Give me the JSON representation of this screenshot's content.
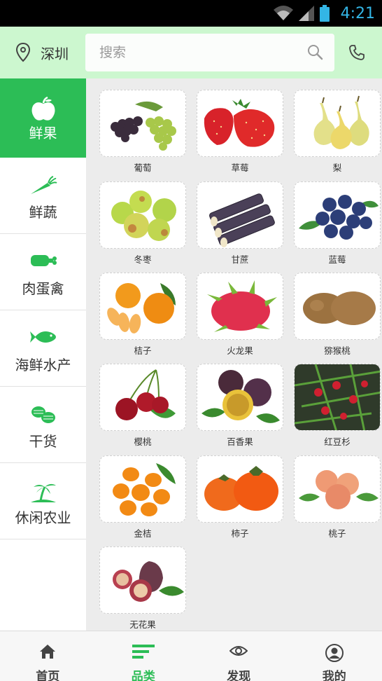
{
  "status": {
    "time": "4:21"
  },
  "header": {
    "city": "深圳",
    "search_placeholder": "搜索"
  },
  "sidebar": {
    "items": [
      {
        "label": "鲜果",
        "icon": "apple-icon",
        "active": true
      },
      {
        "label": "鲜蔬",
        "icon": "carrot-icon",
        "active": false
      },
      {
        "label": "肉蛋禽",
        "icon": "meat-icon",
        "active": false
      },
      {
        "label": "海鲜水产",
        "icon": "fish-icon",
        "active": false
      },
      {
        "label": "干货",
        "icon": "peanut-icon",
        "active": false
      },
      {
        "label": "休闲农业",
        "icon": "palm-island-icon",
        "active": false
      }
    ]
  },
  "products": [
    {
      "name": "葡萄"
    },
    {
      "name": "草莓"
    },
    {
      "name": "梨"
    },
    {
      "name": "冬枣"
    },
    {
      "name": "甘蔗"
    },
    {
      "name": "蓝莓"
    },
    {
      "name": "桔子"
    },
    {
      "name": "火龙果"
    },
    {
      "name": "猕猴桃"
    },
    {
      "name": "樱桃"
    },
    {
      "name": "百香果"
    },
    {
      "name": "红豆杉"
    },
    {
      "name": "金桔"
    },
    {
      "name": "柿子"
    },
    {
      "name": "桃子"
    },
    {
      "name": "无花果"
    }
  ],
  "nav": {
    "tabs": [
      {
        "label": "首页",
        "icon": "home-icon"
      },
      {
        "label": "品类",
        "icon": "category-icon",
        "active": true
      },
      {
        "label": "发现",
        "icon": "eye-icon"
      },
      {
        "label": "我的",
        "icon": "user-icon"
      }
    ]
  },
  "colors": {
    "accent": "#2cbd56",
    "header_bg": "#ccf7cf",
    "status_time": "#33b5e5"
  }
}
